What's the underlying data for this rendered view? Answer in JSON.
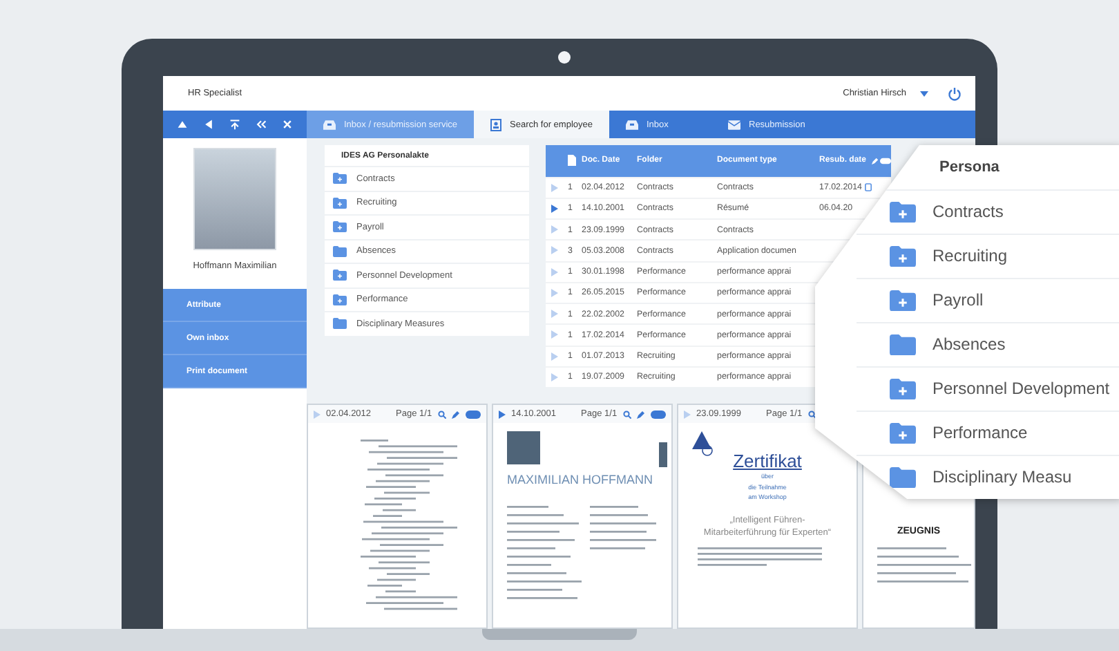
{
  "header": {
    "app_title": "HR Specialist",
    "user": "Christian Hirsch"
  },
  "tabs": [
    {
      "label": "Inbox / resubmission service",
      "selected": false,
      "highlighted": true
    },
    {
      "label": "Search for employee",
      "selected": true,
      "highlighted": false
    },
    {
      "label": "Inbox",
      "selected": false,
      "highlighted": false
    },
    {
      "label": "Resubmission",
      "selected": false,
      "highlighted": false
    }
  ],
  "employee": {
    "name": "Hoffmann Maximilian"
  },
  "side_menu": [
    {
      "label": "Attribute"
    },
    {
      "label": "Own inbox"
    },
    {
      "label": "Print document"
    }
  ],
  "folders": {
    "title": "IDES AG Personalakte",
    "items": [
      {
        "label": "Contracts",
        "expandable": true
      },
      {
        "label": "Recruiting",
        "expandable": true
      },
      {
        "label": "Payroll",
        "expandable": true
      },
      {
        "label": "Absences",
        "expandable": false
      },
      {
        "label": "Personnel Development",
        "expandable": true
      },
      {
        "label": "Performance",
        "expandable": true
      },
      {
        "label": "Disciplinary Measures",
        "expandable": false
      }
    ]
  },
  "table": {
    "columns": [
      "Doc. Date",
      "Folder",
      "Document type",
      "Resub. date"
    ],
    "rows": [
      {
        "count": "1",
        "date": "02.04.2012",
        "folder": "Contracts",
        "type": "Contracts",
        "resub": "17.02.2014",
        "has_note": true,
        "selected": false
      },
      {
        "count": "1",
        "date": "14.10.2001",
        "folder": "Contracts",
        "type": "Résumé",
        "resub": "06.04.20",
        "has_note": false,
        "selected": true
      },
      {
        "count": "1",
        "date": "23.09.1999",
        "folder": "Contracts",
        "type": "Contracts",
        "has_note": false,
        "selected": false
      },
      {
        "count": "3",
        "date": "05.03.2008",
        "folder": "Contracts",
        "type": "Application documen",
        "has_note": false,
        "selected": false
      },
      {
        "count": "1",
        "date": "30.01.1998",
        "folder": "Performance",
        "type": "performance apprai",
        "has_note": false,
        "selected": false
      },
      {
        "count": "1",
        "date": "26.05.2015",
        "folder": "Performance",
        "type": "performance apprai",
        "has_note": false,
        "selected": false
      },
      {
        "count": "1",
        "date": "22.02.2002",
        "folder": "Performance",
        "type": "performance apprai",
        "has_note": false,
        "selected": false
      },
      {
        "count": "1",
        "date": "17.02.2014",
        "folder": "Performance",
        "type": "performance apprai",
        "has_note": false,
        "selected": false
      },
      {
        "count": "1",
        "date": "01.07.2013",
        "folder": "Recruiting",
        "type": "performance apprai",
        "has_note": false,
        "selected": false
      },
      {
        "count": "1",
        "date": "19.07.2009",
        "folder": "Recruiting",
        "type": "performance apprai",
        "has_note": false,
        "selected": false
      }
    ]
  },
  "previews": [
    {
      "kind": "letter",
      "date": "02.04.2012",
      "page": "Page 1/1"
    },
    {
      "kind": "cv",
      "date": "14.10.2001",
      "page": "Page 1/1",
      "title": "MAXIMILIAN HOFFMANN"
    },
    {
      "kind": "certificate",
      "date": "23.09.1999",
      "page": "Page 1/1",
      "title": "Zertifikat",
      "subtitle_lines": [
        "über",
        "die Teilnahme",
        "am Workshop"
      ],
      "quote": "„Intelligent Führen-Mitarbeiterführung für Experten“"
    },
    {
      "kind": "reference",
      "title": "ZEUGNIS"
    }
  ],
  "magnifier": {
    "title": "Persona",
    "items": [
      {
        "label": "Contracts",
        "expandable": true
      },
      {
        "label": "Recruiting",
        "expandable": true
      },
      {
        "label": "Payroll",
        "expandable": true
      },
      {
        "label": "Absences",
        "expandable": false
      },
      {
        "label": "Personnel Development",
        "expandable": true
      },
      {
        "label": "Performance",
        "expandable": true
      },
      {
        "label": "Disciplinary Measu",
        "expandable": false
      }
    ]
  }
}
